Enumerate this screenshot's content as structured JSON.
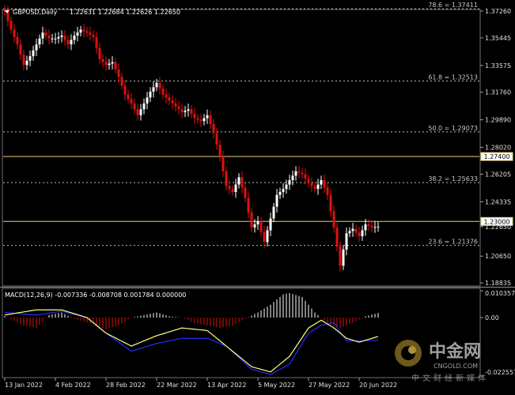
{
  "symbol": "GBPUSD,Daily",
  "ohlc_header": "1.22631 1.22684 1.22626 1.22650",
  "macd_header": "MACD(12,26,9) -0.007336 -0.008708 0.001784 0.000000",
  "colors": {
    "background": "#000000",
    "bull": "#ffffff",
    "bear": "#e01010",
    "fib_line": "#c0c0c0",
    "horizontal_line": "#e8d070",
    "macd_hist_pos": "#ffffff",
    "macd_hist_neg": "#e01010",
    "macd_main": "#ffff80",
    "macd_signal": "#2030ff"
  },
  "fib_levels": [
    {
      "label": "78.6 = 1.37411",
      "value": 1.37411
    },
    {
      "label": "61.8 = 1.32513",
      "value": 1.32513
    },
    {
      "label": "50.0 = 1.29073",
      "value": 1.29073
    },
    {
      "label": "38.2 = 1.25633",
      "value": 1.25633
    },
    {
      "label": "23.6 = 1.21376",
      "value": 1.21376
    }
  ],
  "horizontal_lines": [
    {
      "label": "1.27400",
      "value": 1.274
    },
    {
      "label": "1.23000",
      "value": 1.23
    }
  ],
  "price_scale_labels": [
    "1.37260",
    "1.35445",
    "1.33575",
    "1.31760",
    "1.29890",
    "1.28020",
    "1.26205",
    "1.24335",
    "1.22650",
    "1.20650",
    "1.18835"
  ],
  "macd_scale_labels": [
    "0.010357",
    "0.00",
    "-0.022557"
  ],
  "watermark": {
    "cn": "中金网",
    "en": "CNGOLD.COM",
    "sub": "中文财经新媒体"
  },
  "chart_data": {
    "type": "candlestick",
    "x_labels": [
      "13 Jan 2022",
      "4 Feb 2022",
      "28 Feb 2022",
      "22 Mar 2022",
      "13 Apr 2022",
      "5 May 2022",
      "27 May 2022",
      "20 Jun 2022"
    ],
    "x_label_index": [
      0,
      16,
      32,
      48,
      64,
      80,
      96,
      112
    ],
    "ylim": [
      1.1884,
      1.3726
    ],
    "macd_ylim": [
      -0.0226,
      0.0104
    ],
    "path": [
      [
        0,
        1.372
      ],
      [
        2,
        1.36
      ],
      [
        4,
        1.35
      ],
      [
        6,
        1.336
      ],
      [
        8,
        1.342
      ],
      [
        10,
        1.35
      ],
      [
        12,
        1.358
      ],
      [
        14,
        1.354
      ],
      [
        16,
        1.354
      ],
      [
        18,
        1.356
      ],
      [
        20,
        1.35
      ],
      [
        22,
        1.356
      ],
      [
        24,
        1.36
      ],
      [
        26,
        1.358
      ],
      [
        28,
        1.355
      ],
      [
        30,
        1.34
      ],
      [
        32,
        1.336
      ],
      [
        34,
        1.338
      ],
      [
        36,
        1.328
      ],
      [
        38,
        1.316
      ],
      [
        40,
        1.31
      ],
      [
        42,
        1.302
      ],
      [
        44,
        1.31
      ],
      [
        46,
        1.318
      ],
      [
        48,
        1.324
      ],
      [
        50,
        1.316
      ],
      [
        52,
        1.312
      ],
      [
        54,
        1.308
      ],
      [
        56,
        1.304
      ],
      [
        58,
        1.306
      ],
      [
        60,
        1.3
      ],
      [
        62,
        1.298
      ],
      [
        64,
        1.302
      ],
      [
        66,
        1.29
      ],
      [
        68,
        1.274
      ],
      [
        70,
        1.254
      ],
      [
        72,
        1.25
      ],
      [
        74,
        1.26
      ],
      [
        76,
        1.246
      ],
      [
        78,
        1.226
      ],
      [
        80,
        1.23
      ],
      [
        82,
        1.216
      ],
      [
        84,
        1.232
      ],
      [
        86,
        1.248
      ],
      [
        88,
        1.252
      ],
      [
        90,
        1.258
      ],
      [
        92,
        1.264
      ],
      [
        94,
        1.262
      ],
      [
        96,
        1.256
      ],
      [
        98,
        1.252
      ],
      [
        100,
        1.258
      ],
      [
        102,
        1.248
      ],
      [
        104,
        1.226
      ],
      [
        106,
        1.2
      ],
      [
        108,
        1.222
      ],
      [
        110,
        1.225
      ],
      [
        112,
        1.22
      ],
      [
        114,
        1.228
      ],
      [
        116,
        1.226
      ],
      [
        118,
        1.2265
      ]
    ],
    "macd_main_path": [
      [
        0,
        0.001
      ],
      [
        10,
        0.003
      ],
      [
        18,
        0.003
      ],
      [
        26,
        0.0
      ],
      [
        32,
        -0.006
      ],
      [
        40,
        -0.011
      ],
      [
        48,
        -0.007
      ],
      [
        56,
        -0.004
      ],
      [
        64,
        -0.005
      ],
      [
        70,
        -0.011
      ],
      [
        78,
        -0.019
      ],
      [
        84,
        -0.021
      ],
      [
        90,
        -0.015
      ],
      [
        96,
        -0.004
      ],
      [
        100,
        -0.001
      ],
      [
        104,
        -0.004
      ],
      [
        108,
        -0.008
      ],
      [
        112,
        -0.0095
      ],
      [
        118,
        -0.0073
      ]
    ],
    "macd_signal_path": [
      [
        0,
        0.002
      ],
      [
        10,
        0.001
      ],
      [
        18,
        0.0025
      ],
      [
        26,
        0.0
      ],
      [
        32,
        -0.006
      ],
      [
        40,
        -0.013
      ],
      [
        48,
        -0.01
      ],
      [
        56,
        -0.008
      ],
      [
        64,
        -0.008
      ],
      [
        70,
        -0.011
      ],
      [
        78,
        -0.02
      ],
      [
        84,
        -0.022
      ],
      [
        90,
        -0.018
      ],
      [
        96,
        -0.006
      ],
      [
        100,
        -0.003
      ],
      [
        104,
        -0.002
      ],
      [
        108,
        -0.009
      ],
      [
        112,
        -0.009
      ],
      [
        118,
        -0.0087
      ]
    ],
    "macd_hist_path": [
      [
        0,
        0.0005
      ],
      [
        6,
        -0.003
      ],
      [
        10,
        -0.004
      ],
      [
        14,
        0.001
      ],
      [
        18,
        0.002
      ],
      [
        22,
        -0.0005
      ],
      [
        28,
        -0.0025
      ],
      [
        32,
        -0.0045
      ],
      [
        36,
        -0.003
      ],
      [
        40,
        0.0
      ],
      [
        44,
        0.001
      ],
      [
        48,
        0.002
      ],
      [
        52,
        0.0005
      ],
      [
        56,
        0.0
      ],
      [
        60,
        -0.002
      ],
      [
        64,
        -0.003
      ],
      [
        68,
        -0.004
      ],
      [
        72,
        -0.003
      ],
      [
        76,
        -0.0005
      ],
      [
        80,
        0.002
      ],
      [
        84,
        0.005
      ],
      [
        88,
        0.009
      ],
      [
        90,
        0.0095
      ],
      [
        94,
        0.008
      ],
      [
        98,
        0.002
      ],
      [
        102,
        -0.002
      ],
      [
        106,
        -0.004
      ],
      [
        110,
        -0.002
      ],
      [
        114,
        0.0005
      ],
      [
        118,
        0.0018
      ]
    ]
  }
}
